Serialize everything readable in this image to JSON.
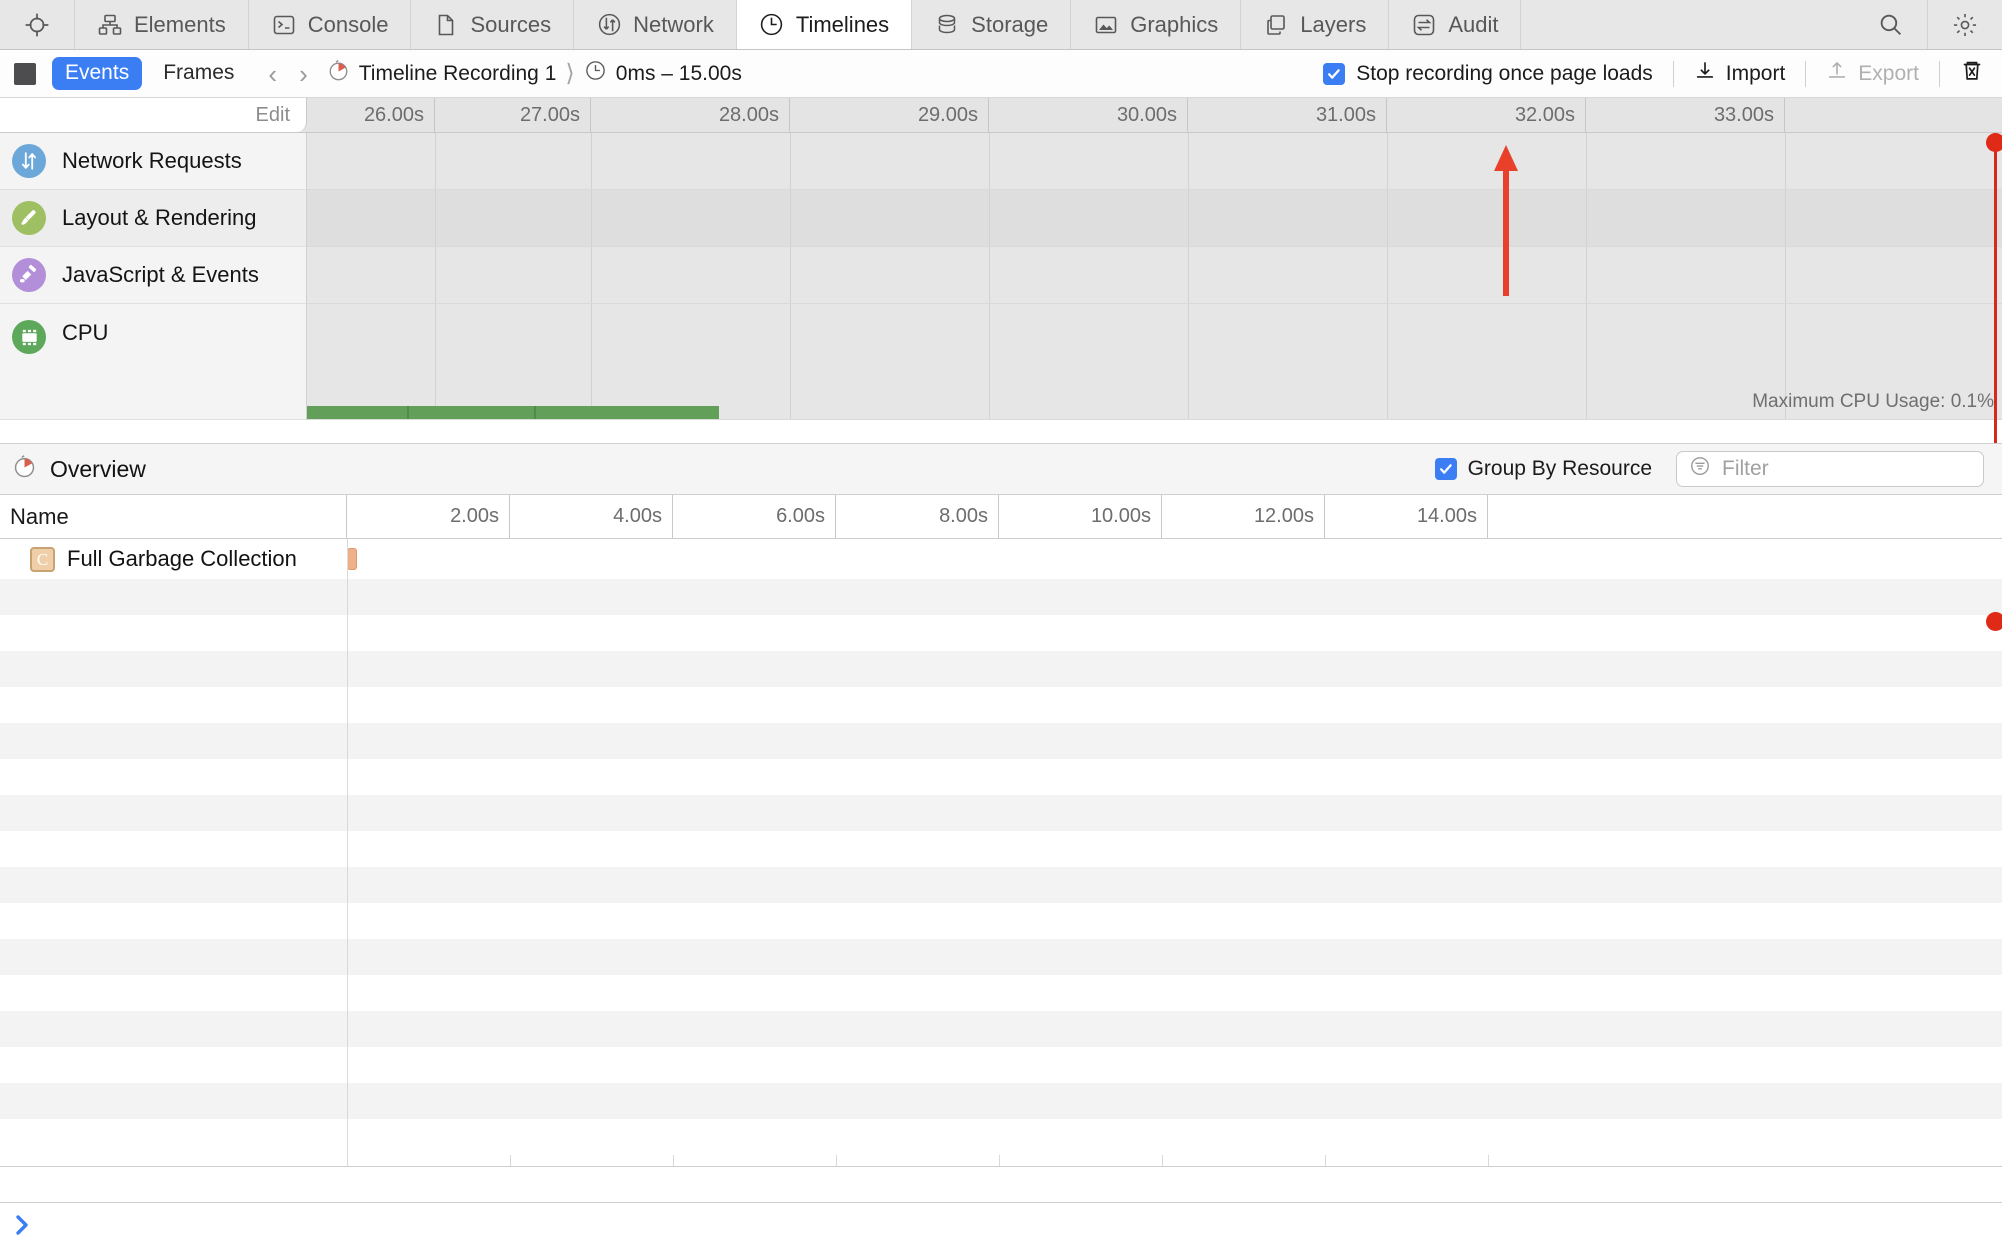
{
  "tabs": [
    {
      "label": "",
      "icon": "inspect-target-icon",
      "active": false,
      "iconOnly": true
    },
    {
      "label": "Elements",
      "icon": "elements-icon",
      "active": false
    },
    {
      "label": "Console",
      "icon": "console-icon",
      "active": false
    },
    {
      "label": "Sources",
      "icon": "sources-icon",
      "active": false
    },
    {
      "label": "Network",
      "icon": "network-icon",
      "active": false
    },
    {
      "label": "Timelines",
      "icon": "timelines-icon",
      "active": true
    },
    {
      "label": "Storage",
      "icon": "storage-icon",
      "active": false
    },
    {
      "label": "Graphics",
      "icon": "graphics-icon",
      "active": false
    },
    {
      "label": "Layers",
      "icon": "layers-icon",
      "active": false
    },
    {
      "label": "Audit",
      "icon": "audit-icon",
      "active": false
    },
    {
      "label": "",
      "icon": "search-icon",
      "active": false,
      "iconOnly": true
    },
    {
      "label": "",
      "icon": "gear-icon",
      "active": false,
      "iconOnly": true
    }
  ],
  "toolbar": {
    "record_button": "record-stop-button",
    "segments": [
      {
        "label": "Events",
        "selected": true
      },
      {
        "label": "Frames",
        "selected": false
      }
    ],
    "nav_prev": "‹",
    "nav_next": "›",
    "breadcrumb_recording": "Timeline Recording 1",
    "breadcrumb_separator": "⟩",
    "breadcrumb_range": "0ms – 15.00s",
    "stop_recording_label": "Stop recording once page loads",
    "stop_recording_checked": true,
    "import_label": "Import",
    "export_label": "Export",
    "export_disabled": true,
    "clear_label": "clear-timeline-icon"
  },
  "timeline_overview": {
    "edit_label": "Edit",
    "ruler_ticks": [
      "26.00s",
      "27.00s",
      "28.00s",
      "29.00s",
      "30.00s",
      "31.00s",
      "32.00s",
      "33.00s"
    ],
    "rows": [
      {
        "label": "Network Requests",
        "icon": "network-requests-icon",
        "color": "#6ba7d8"
      },
      {
        "label": "Layout & Rendering",
        "icon": "layout-rendering-icon",
        "color": "#9fbf63"
      },
      {
        "label": "JavaScript & Events",
        "icon": "javascript-events-icon",
        "color": "#b28fd8"
      },
      {
        "label": "CPU",
        "icon": "cpu-icon",
        "color": "#5da85a"
      }
    ],
    "cpu_max_label": "Maximum CPU Usage: 0.1%",
    "annotation_arrow": "red-up-arrow-annotation",
    "recording_marker": "red-recording-marker"
  },
  "overview_bar": {
    "title": "Overview",
    "title_icon": "stopwatch-icon",
    "group_by_resource_label": "Group By Resource",
    "group_by_resource_checked": true,
    "filter_placeholder": "Filter",
    "filter_value": "",
    "filter_icon": "filter-icon"
  },
  "datagrid": {
    "columns": [
      "Name"
    ],
    "ruler_ticks": [
      "2.00s",
      "4.00s",
      "6.00s",
      "8.00s",
      "10.00s",
      "12.00s",
      "14.00s"
    ],
    "rows": [
      {
        "name": "Full Garbage Collection",
        "icon": "gc-record-icon",
        "icon_glyph": "C",
        "bar_start_pct": 0.3,
        "bar_width_pct": 0.45
      }
    ]
  },
  "bottom_bar": {
    "expand_icon": "chevron-right-icon"
  },
  "colors": {
    "accent": "#3b7ef4",
    "marker_red": "#d8281c",
    "cpu_green": "#62a05a",
    "gc_orange": "#eeb088",
    "tab_active_bg": "#ffffff",
    "tabbar_bg": "#e7e7e7"
  }
}
